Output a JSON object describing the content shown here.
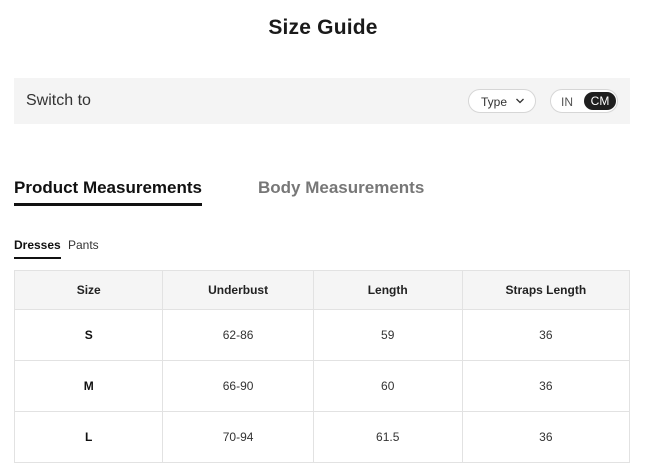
{
  "page": {
    "title": "Size Guide"
  },
  "switch_bar": {
    "label": "Switch to",
    "type_dropdown": {
      "label": "Type",
      "icon": "chevron-down-icon"
    },
    "unit_toggle": {
      "options": [
        "IN",
        "CM"
      ],
      "selected": "CM"
    }
  },
  "tabs": {
    "product": "Product Measurements",
    "body": "Body Measurements",
    "active": "Product Measurements"
  },
  "subtabs": {
    "dresses": "Dresses",
    "pants": "Pants",
    "active": "Dresses"
  },
  "table": {
    "headers": [
      "Size",
      "Underbust",
      "Length",
      "Straps Length"
    ],
    "rows": [
      [
        "S",
        "62-86",
        "59",
        "36"
      ],
      [
        "M",
        "66-90",
        "60",
        "36"
      ],
      [
        "L",
        "70-94",
        "61.5",
        "36"
      ]
    ]
  },
  "colors": {
    "accent": "#1f1f1f",
    "bar_background": "#f4f4f4",
    "border": "#e2e2e2",
    "inactive_tab": "#777777"
  }
}
